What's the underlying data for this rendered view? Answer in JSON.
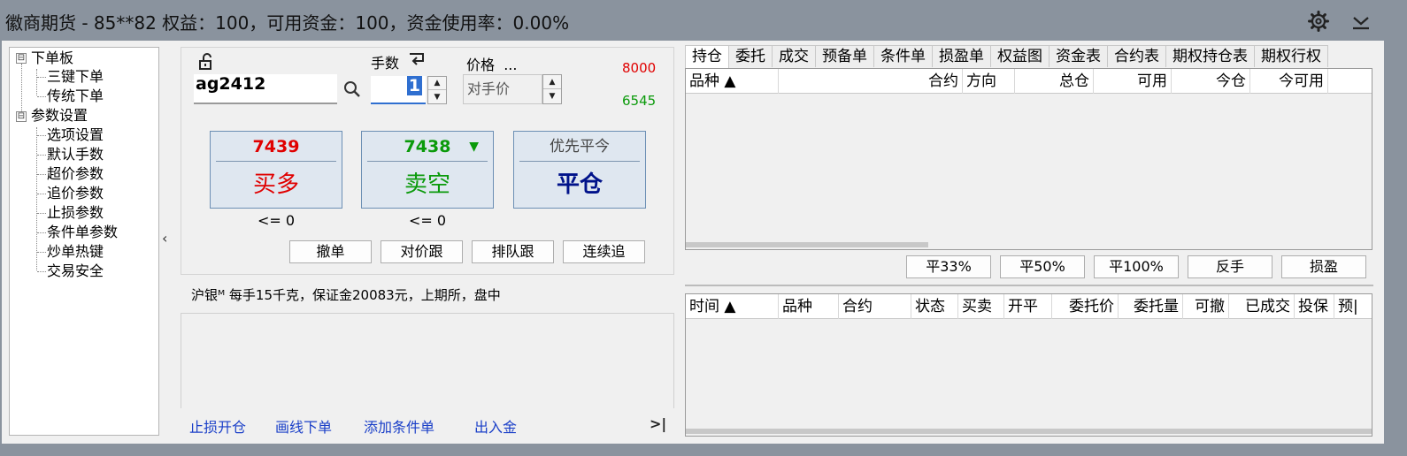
{
  "titlebar": {
    "title": "徽商期货 - 85**82  权益：100，可用资金：100，资金使用率：0.00%",
    "settings_icon": "gear-icon",
    "menu_icon": "chevron-down-icon"
  },
  "tree": {
    "groups": [
      {
        "label": "下单板",
        "toggle": "⊟",
        "items": [
          "三键下单",
          "传统下单"
        ]
      },
      {
        "label": "参数设置",
        "toggle": "⊟",
        "items": [
          "选项设置",
          "默认手数",
          "超价参数",
          "追价参数",
          "止损参数",
          "条件单参数",
          "炒单热键",
          "交易安全"
        ]
      }
    ],
    "collapse_glyph": "‹"
  },
  "order": {
    "contract": "ag2412",
    "qty_label": "手数",
    "qty_value": "1",
    "price_label": "价格",
    "price_more": "...",
    "price_value": "对手价",
    "limit_up": "8000",
    "limit_down": "6545",
    "colors": {
      "up": "#e00000",
      "down": "#0a9a0a",
      "close": "#00128a"
    },
    "buy": {
      "price": "7439",
      "label": "买多",
      "limit": "<= 0"
    },
    "sell": {
      "price": "7438",
      "label": "卖空",
      "limit": "<= 0",
      "arrow": "▼"
    },
    "close": {
      "top": "优先平今",
      "label": "平仓"
    },
    "small_buttons": [
      "撤单",
      "对价跟",
      "排队跟",
      "连续追"
    ],
    "info": "沪银ᴹ   每手15千克，保证金20083元，上期所，盘中",
    "links": [
      "止损开仓",
      "画线下单",
      "添加条件单",
      "出入金"
    ],
    "expand_glyph": ">|"
  },
  "positions": {
    "tabs": [
      "持仓",
      "委托",
      "成交",
      "预备单",
      "条件单",
      "损盈单",
      "权益图",
      "资金表",
      "合约表",
      "期权持仓表",
      "期权行权"
    ],
    "active_tab": 0,
    "columns": [
      "品种 ▲",
      "合约",
      "方向",
      "总仓",
      "可用",
      "今仓",
      "今可用"
    ],
    "actions": [
      "平33%",
      "平50%",
      "平100%",
      "反手",
      "损盈"
    ]
  },
  "orders": {
    "columns": [
      "时间 ▲",
      "品种",
      "合约",
      "状态",
      "买卖",
      "开平",
      "委托价",
      "委托量",
      "可撤",
      "已成交",
      "投保",
      "预|"
    ]
  }
}
